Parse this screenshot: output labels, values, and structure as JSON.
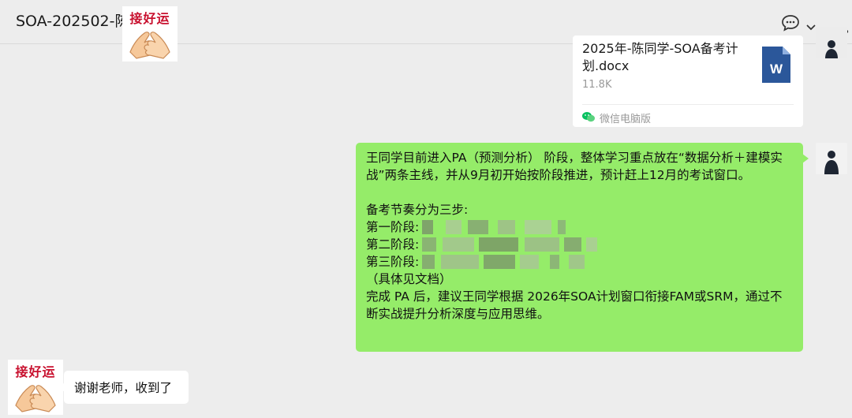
{
  "header": {
    "title": "SOA-202502-陈",
    "chat_info_icon": "chat-bubble-icon",
    "dropdown_icon": "chevron-down-icon",
    "more_icon": "more-dots-icon"
  },
  "stickers": {
    "top_text": "接好运",
    "bottom_text": "接好运"
  },
  "file_message": {
    "file_name": "2025年-陈同学-SOA备考计划.docx",
    "file_size": "11.8K",
    "source": "微信电脑版",
    "file_icon": "word-doc-icon",
    "file_icon_letter": "W"
  },
  "message_plan": {
    "line1": "王同学目前进入PA（预测分析） 阶段，整体学习重点放在“数据分析＋建模实战”两条主线，并从9月初开始按阶段推进，预计赶上12月的考试窗口。",
    "rhythm_title": "备考节奏分为三步:",
    "stage1": "第一阶段:",
    "stage2": "第二阶段:",
    "stage3": "第三阶段:",
    "see_doc": "（具体见文档）",
    "conclusion": "完成 PA 后，建议王同学根据 2026年SOA计划窗口衔接FAM或SRM，通过不断实战提升分析深度与应用思维。"
  },
  "reply": {
    "text": "谢谢老师，收到了"
  },
  "colors": {
    "background": "#ededed",
    "green_bubble": "#95ec69",
    "white_bubble": "#ffffff",
    "sticker_text": "#c8102e",
    "word_blue": "#2b579a"
  }
}
